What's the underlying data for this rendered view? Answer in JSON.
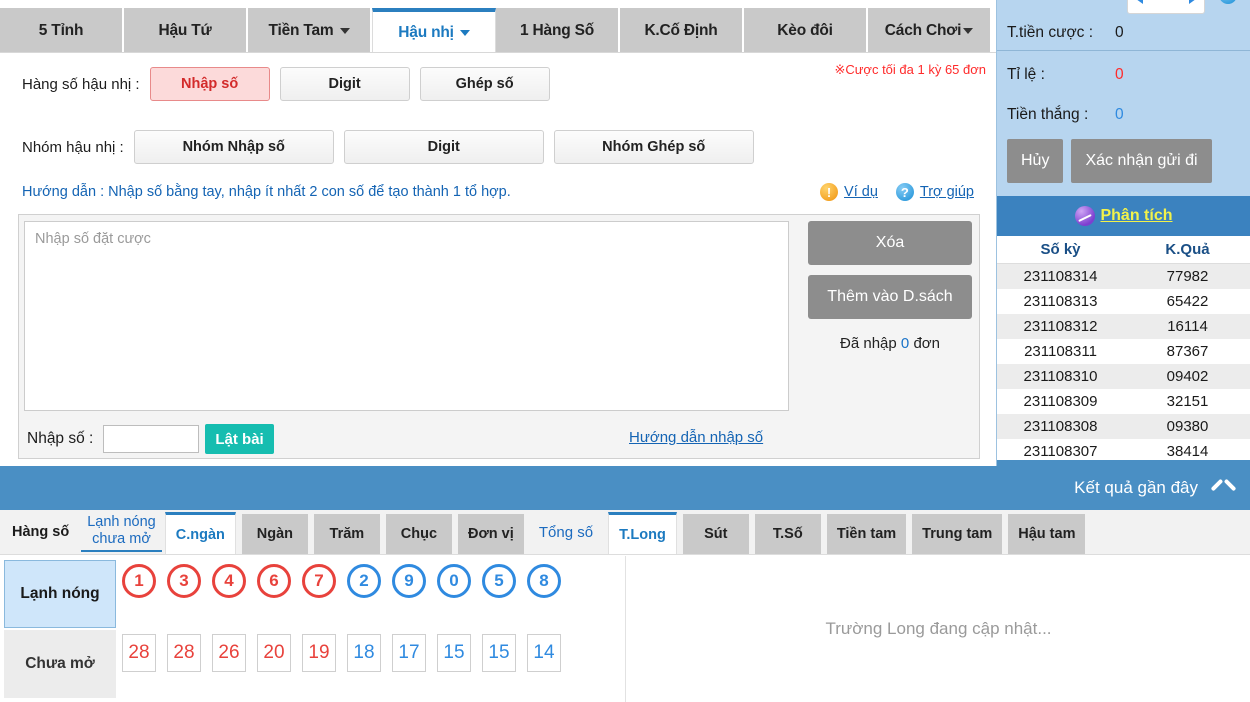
{
  "top_tabs": [
    {
      "label": "5 Tỉnh",
      "active": false,
      "caret": false
    },
    {
      "label": "Hậu Tứ",
      "active": false,
      "caret": false
    },
    {
      "label": "Tiền Tam",
      "active": false,
      "caret": true
    },
    {
      "label": "Hậu nhị",
      "active": true,
      "caret": true
    },
    {
      "label": "1 Hàng Số",
      "active": false,
      "caret": false
    },
    {
      "label": "K.Cố Định",
      "active": false,
      "caret": false
    },
    {
      "label": "Kèo đôi",
      "active": false,
      "caret": false
    },
    {
      "label": "Cách Chơi",
      "active": false,
      "caret": true
    }
  ],
  "options": {
    "row1_label": "Hàng số hậu nhị :",
    "row1_buttons": [
      {
        "label": "Nhập số",
        "selected": true
      },
      {
        "label": "Digit",
        "selected": false
      },
      {
        "label": "Ghép số",
        "selected": false
      }
    ],
    "row2_label": "Nhóm hậu nhị :",
    "row2_buttons": [
      {
        "label": "Nhóm Nhập số",
        "selected": false
      },
      {
        "label": "Digit",
        "selected": false
      },
      {
        "label": "Nhóm Ghép số",
        "selected": false
      }
    ],
    "max_note": "※Cược tối đa 1 kỳ 65 đơn"
  },
  "guide": {
    "text": "Hướng dẫn : Nhập số bằng tay, nhập ít nhất 2 con số để tạo thành 1 tổ hợp.",
    "example_icon": "warning-icon",
    "example_label": "Ví dụ",
    "help_icon": "help-icon",
    "help_label": "Trợ giúp"
  },
  "betbox": {
    "textarea_placeholder": "Nhập số đặt cược",
    "textarea_value": "",
    "clear_label": "Xóa",
    "add_label": "Thêm vào D.sách",
    "entered_prefix": "Đã nhập",
    "entered_count": "0",
    "entered_suffix": "đơn",
    "foot_label": "Nhập số :",
    "foot_input_value": "",
    "flip_label": "Lật bài",
    "foot_link": "Hướng dẫn nhập số"
  },
  "recent_bar": {
    "label": "Kết quả gần đây",
    "chevron": "chevron-up-icon"
  },
  "bottom_tabs": {
    "left_label": "Hàng số",
    "left_active": "Lạnh nóng chưa mở",
    "left_active_line1": "Lạnh nóng",
    "left_active_line2": "chưa mở",
    "digits": [
      {
        "label": "C.ngàn",
        "active": true
      },
      {
        "label": "Ngàn",
        "active": false
      },
      {
        "label": "Trăm",
        "active": false
      },
      {
        "label": "Chục",
        "active": false
      },
      {
        "label": "Đơn vị",
        "active": false
      }
    ],
    "mid_label": "Tổng số",
    "right_tabs": [
      {
        "label": "T.Long",
        "active": true
      },
      {
        "label": "Sút",
        "active": false
      },
      {
        "label": "T.Số",
        "active": false
      },
      {
        "label": "Tiền tam",
        "active": false
      },
      {
        "label": "Trung tam",
        "active": false
      },
      {
        "label": "Hậu tam",
        "active": false
      }
    ]
  },
  "hotcold": {
    "hot_label": "Lạnh nóng",
    "cold_label": "Chưa mở",
    "balls": [
      {
        "num": "1",
        "color": "red"
      },
      {
        "num": "3",
        "color": "red"
      },
      {
        "num": "4",
        "color": "red"
      },
      {
        "num": "6",
        "color": "red"
      },
      {
        "num": "7",
        "color": "red"
      },
      {
        "num": "2",
        "color": "blue"
      },
      {
        "num": "9",
        "color": "blue"
      },
      {
        "num": "0",
        "color": "blue"
      },
      {
        "num": "5",
        "color": "blue"
      },
      {
        "num": "8",
        "color": "blue"
      }
    ],
    "counts": [
      {
        "num": "28",
        "color": "red"
      },
      {
        "num": "28",
        "color": "red"
      },
      {
        "num": "26",
        "color": "red"
      },
      {
        "num": "20",
        "color": "red"
      },
      {
        "num": "19",
        "color": "red"
      },
      {
        "num": "18",
        "color": "blue"
      },
      {
        "num": "17",
        "color": "blue"
      },
      {
        "num": "15",
        "color": "blue"
      },
      {
        "num": "15",
        "color": "blue"
      },
      {
        "num": "14",
        "color": "blue"
      }
    ]
  },
  "updating_message": "Trường Long đang cập nhật...",
  "right_panel": {
    "total_bet_label": "T.tiền cược :",
    "total_bet_value": "0",
    "rate_label": "Tỉ lệ :",
    "rate_value": "0",
    "win_label": "Tiền thắng :",
    "win_value": "0",
    "cancel_label": "Hủy",
    "confirm_label": "Xác nhận gửi đi",
    "analyze_label": "Phân tích",
    "analyze_icon": "analytics-icon",
    "table_headers": [
      "Số kỳ",
      "K.Quả"
    ],
    "table_rows": [
      [
        "231108314",
        "77982"
      ],
      [
        "231108313",
        "65422"
      ],
      [
        "231108312",
        "16114"
      ],
      [
        "231108311",
        "87367"
      ],
      [
        "231108310",
        "09402"
      ],
      [
        "231108309",
        "32151"
      ],
      [
        "231108308",
        "09380"
      ],
      [
        "231108307",
        "38414"
      ]
    ]
  },
  "colors": {
    "accent_blue": "#2b7fbf",
    "panel_blue": "#b7d5ef",
    "bar_blue": "#4a8fc4",
    "red": "#e8423c",
    "teal": "#16bdb0",
    "yellow_link": "#f2f24a"
  }
}
